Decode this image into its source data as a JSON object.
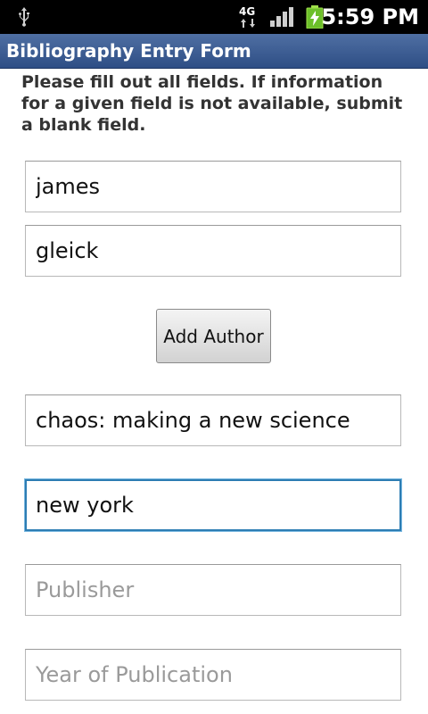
{
  "status_bar": {
    "network_label": "4G",
    "time": "5:59 PM",
    "icons": [
      "usb-icon",
      "4g-icon",
      "signal-icon",
      "battery-icon"
    ]
  },
  "title_bar": {
    "title": "Bibliography Entry Form"
  },
  "instructions": "Please fill out all fields. If information for a given field is not available, submit a blank field.",
  "form": {
    "author_first_name": {
      "value": "james"
    },
    "author_last_name": {
      "value": "gleick"
    },
    "add_author_label": "Add Author",
    "title_field": {
      "value": "chaos: making a new science"
    },
    "city_field": {
      "value": "new york"
    },
    "publisher_field": {
      "value": "",
      "placeholder": "Publisher"
    },
    "year_field": {
      "value": "",
      "placeholder": "Year of Publication"
    }
  },
  "colors": {
    "title_bar": "#3b5b92",
    "focus_border": "#2d7db3",
    "status_bar": "#000000"
  }
}
